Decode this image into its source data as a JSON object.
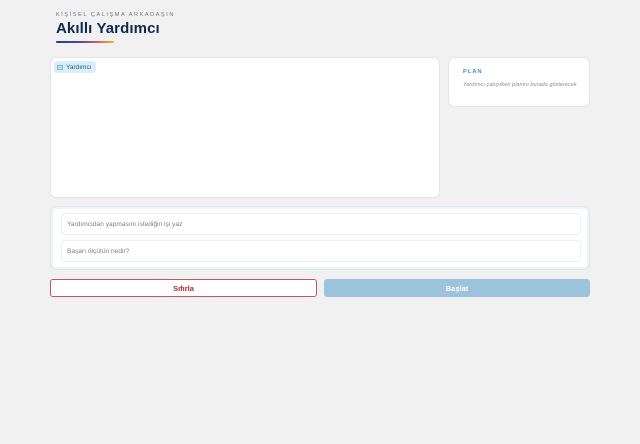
{
  "header": {
    "eyebrow": "KİŞİSEL ÇALIŞMA ARKADAŞIN",
    "title": "Akıllı Yardımcı"
  },
  "chat": {
    "assistant_chip": {
      "icon": "bot-icon",
      "label": "Yardımcı"
    }
  },
  "plan": {
    "title": "PLAN",
    "empty_text": "Yardımcı çalışırken planını burada gösterecek"
  },
  "form": {
    "task_placeholder": "Yardımcıdan yapmasını istediğin işi yaz",
    "task_value": "",
    "criteria_placeholder": "Başarı ölçütün nedir?",
    "criteria_value": ""
  },
  "actions": {
    "reset_label": "Sıfırla",
    "start_label": "Başlat"
  },
  "colors": {
    "title": "#0f2a4a",
    "chip_bg": "#d9eef8",
    "plan_accent": "#3a8fc0",
    "reset_accent": "#b2262e",
    "start_disabled": "#9cc3db"
  }
}
